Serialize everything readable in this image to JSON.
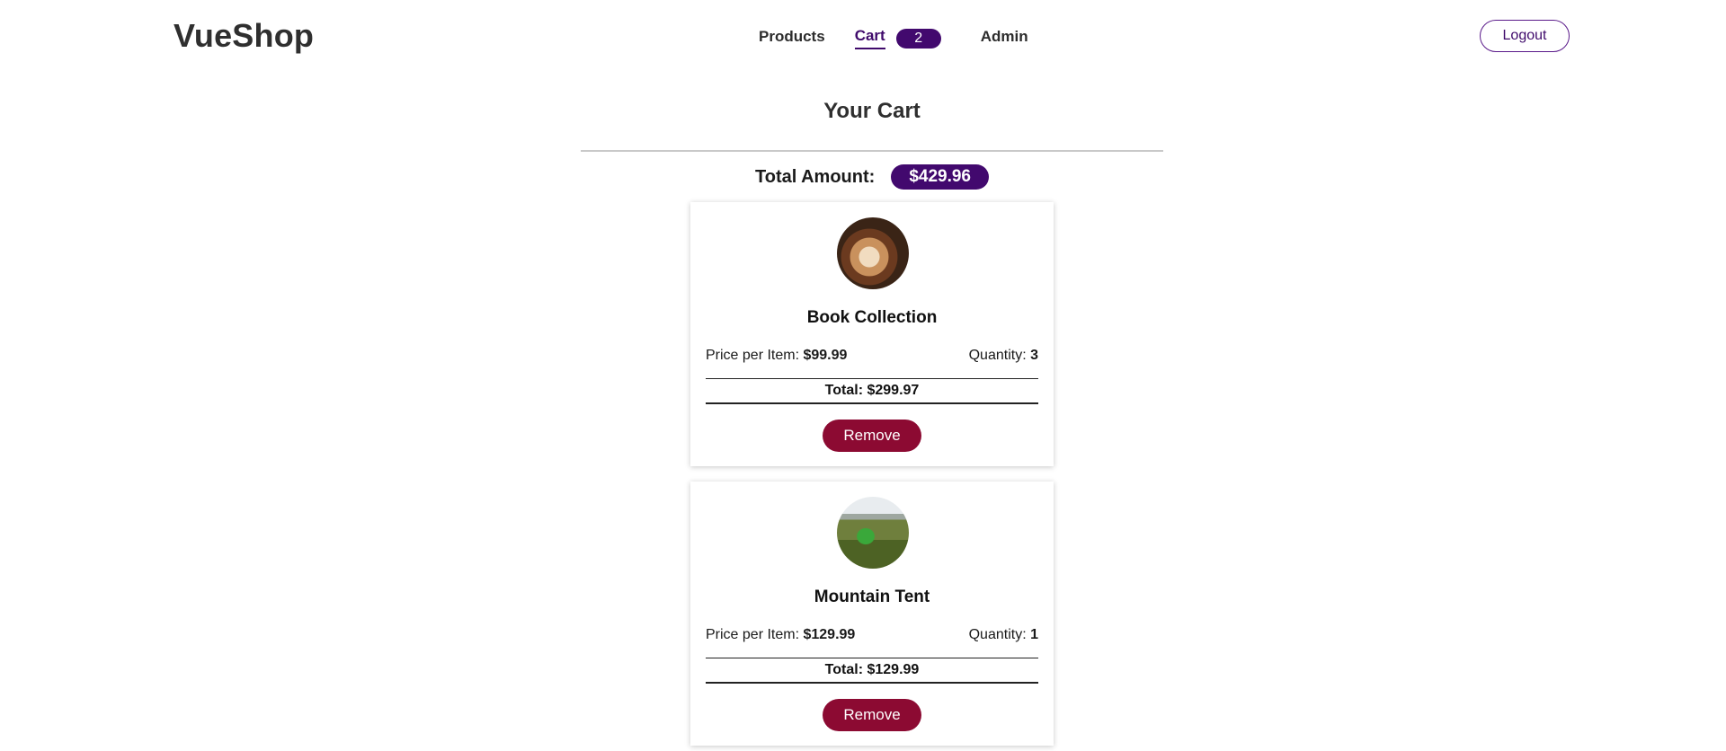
{
  "header": {
    "brand": "VueShop",
    "nav": {
      "products": "Products",
      "cart": "Cart",
      "cart_count": "2",
      "admin": "Admin"
    },
    "logout_label": "Logout"
  },
  "cart": {
    "title": "Your Cart",
    "total_label": "Total Amount:",
    "total_value": "$429.96",
    "items": [
      {
        "name": "Book Collection",
        "image": "book-collection-photo",
        "price_label": "Price per Item:",
        "price": "$99.99",
        "quantity_label": "Quantity:",
        "quantity": "3",
        "total": "Total: $299.97",
        "remove_label": "Remove"
      },
      {
        "name": "Mountain Tent",
        "image": "mountain-tent-photo",
        "price_label": "Price per Item:",
        "price": "$129.99",
        "quantity_label": "Quantity:",
        "quantity": "1",
        "total": "Total: $129.99",
        "remove_label": "Remove"
      }
    ]
  },
  "colors": {
    "accent": "#42096e",
    "remove": "#8c0a32"
  }
}
